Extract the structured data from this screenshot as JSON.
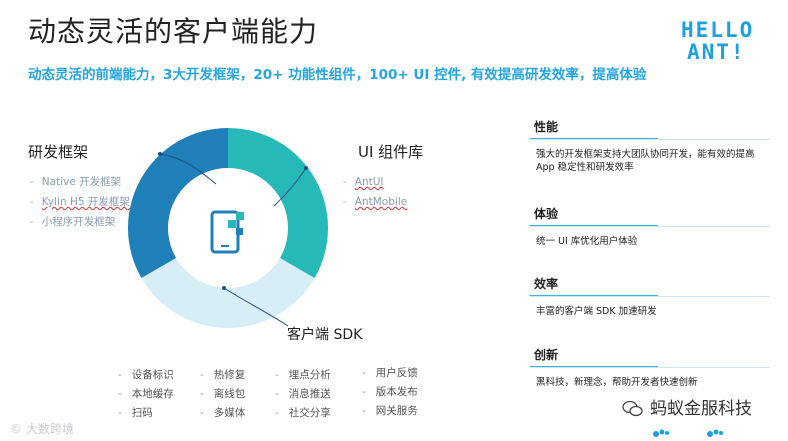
{
  "header": {
    "title": "动态灵活的客户端能力",
    "subtitle": "动态灵活的前端能力，3大开发框架，20+ 功能性组件，100+ UI 控件, 有效提高研发效率，提高体验",
    "logo_line1": "HELLO",
    "logo_line2": "ANT!"
  },
  "colors": {
    "accent_blue": "#25a5e0",
    "donut_dark": "#1f7fb8",
    "donut_teal": "#27b8b8",
    "donut_light": "#d8eef6"
  },
  "left": {
    "rd_title": "研发框架",
    "rd_items": [
      "Native 开发框架",
      "Kylin H5 开发框架",
      "小程序开发框架"
    ],
    "ui_title": "UI 组件库",
    "ui_items": [
      "AntUI",
      "AntMobile"
    ],
    "sdk_title": "客户端 SDK",
    "donut_icon": "mobile-blocks-icon"
  },
  "features": {
    "col1": [
      "设备标识",
      "本地缓存",
      "扫码"
    ],
    "col2": [
      "热修复",
      "离线包",
      "多媒体"
    ],
    "col3": [
      "埋点分析",
      "消息推送",
      "社交分享"
    ],
    "col4": [
      "用户反馈",
      "版本发布",
      "网关服务"
    ]
  },
  "right": {
    "s1": {
      "title": "性能",
      "body": "强大的开发框架支持大团队协同开发，能有效的提高 App 稳定性和研发效率"
    },
    "s2": {
      "title": "体验",
      "body": "统一 UI 库优化用户体验"
    },
    "s3": {
      "title": "效率",
      "body": "丰富的客户端 SDK 加速研发"
    },
    "s4": {
      "title": "创新",
      "body": "黑科技，新理念，帮助开发者快速创新"
    }
  },
  "watermarks": {
    "left": "大数跨境",
    "right": "蚂蚁金服科技"
  }
}
